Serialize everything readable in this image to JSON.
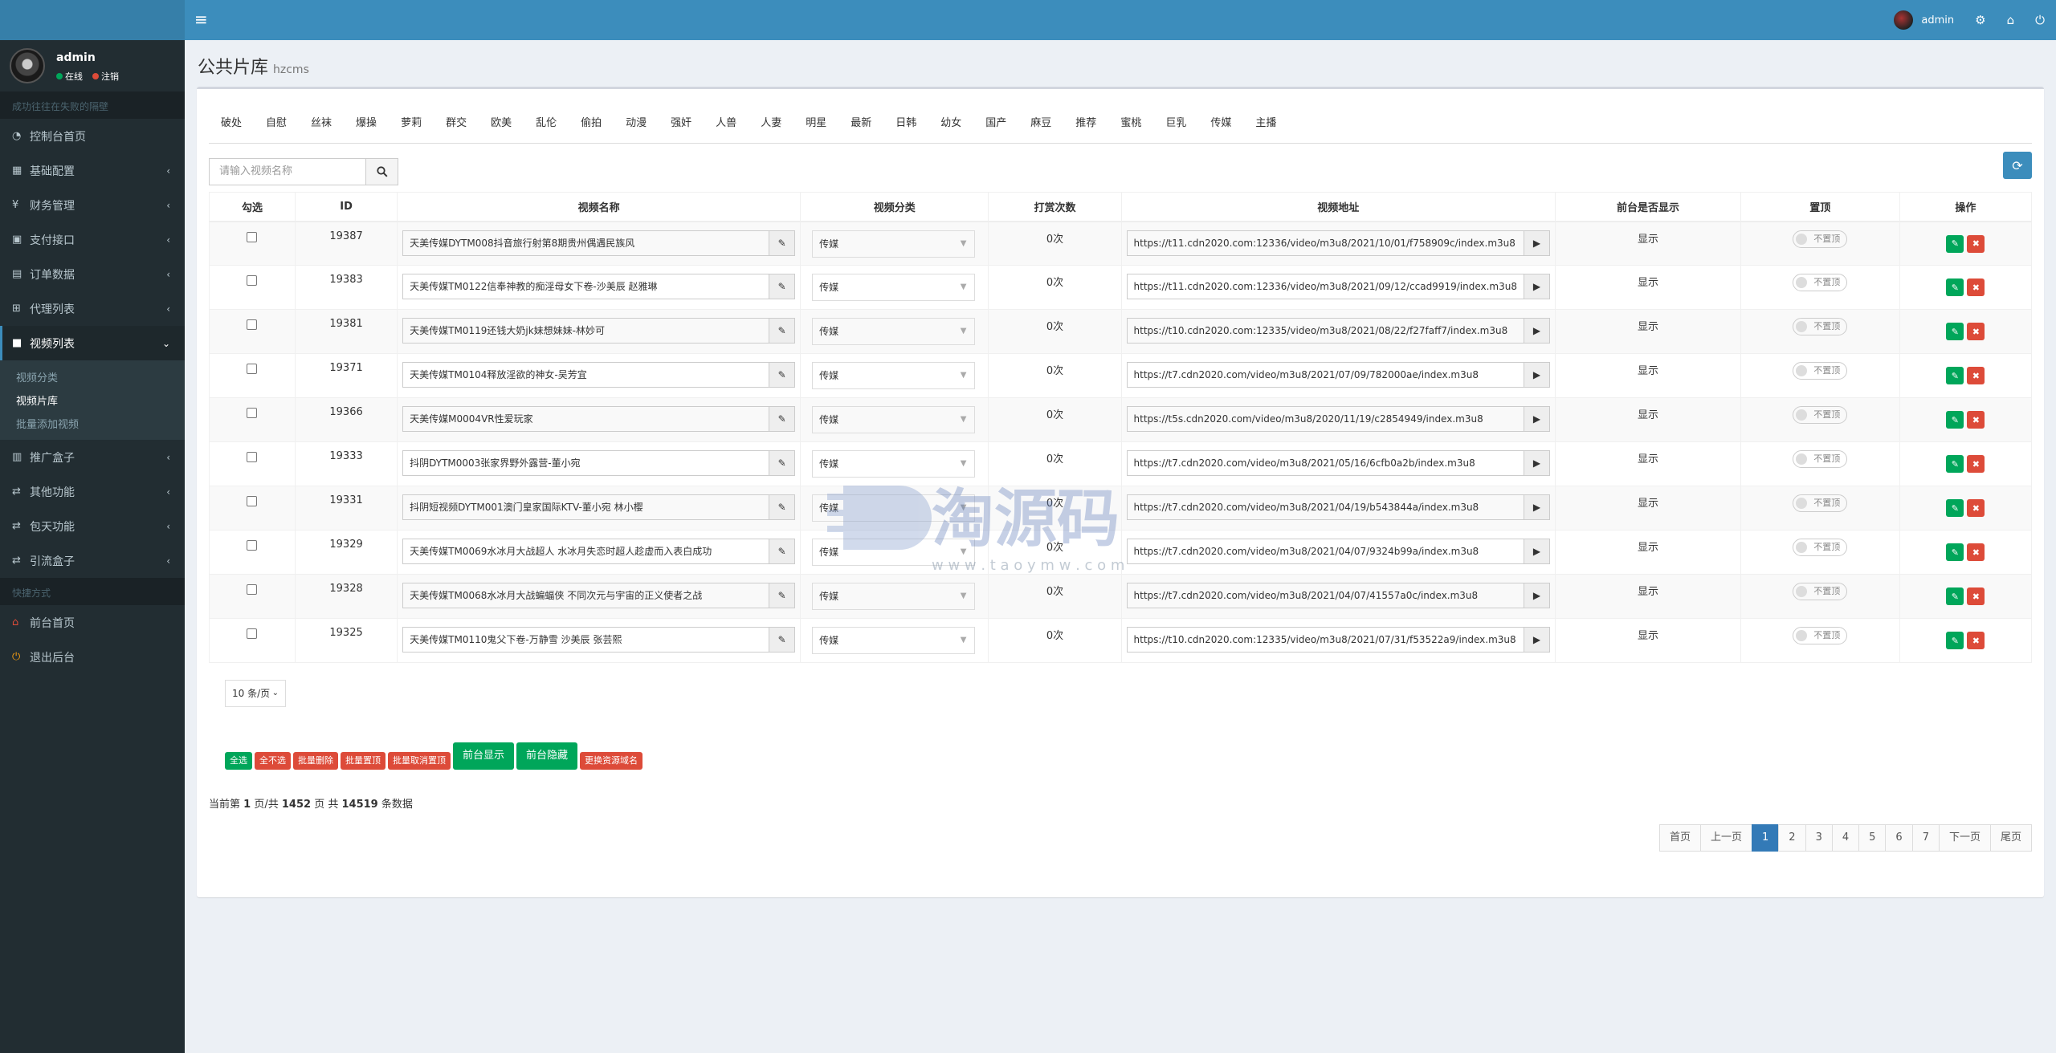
{
  "topbar": {
    "username": "admin"
  },
  "sidebar": {
    "user": {
      "name": "admin",
      "status_online": "在线",
      "status_logout": "注销"
    },
    "header1": "成功往往在失败的隔壁",
    "header2": "快捷方式",
    "items": [
      {
        "label": "控制台首页",
        "icon": "dashboard-icon"
      },
      {
        "label": "基础配置",
        "icon": "grid-icon"
      },
      {
        "label": "财务管理",
        "icon": "yen-icon"
      },
      {
        "label": "支付接口",
        "icon": "card-icon"
      },
      {
        "label": "订单数据",
        "icon": "chart-icon"
      },
      {
        "label": "代理列表",
        "icon": "sitemap-icon"
      },
      {
        "label": "视频列表",
        "icon": "video-icon"
      },
      {
        "label": "推广盒子",
        "icon": "table-icon"
      },
      {
        "label": "其他功能",
        "icon": "retweet-icon"
      },
      {
        "label": "包天功能",
        "icon": "retweet-icon"
      },
      {
        "label": "引流盒子",
        "icon": "retweet-icon"
      }
    ],
    "sub": [
      "视频分类",
      "视频片库",
      "批量添加视频"
    ],
    "shortcuts": [
      {
        "label": "前台首页",
        "icon": "home-icon"
      },
      {
        "label": "退出后台",
        "icon": "power-icon"
      }
    ]
  },
  "page": {
    "title": "公共片库",
    "subtitle": "hzcms"
  },
  "tabs": [
    "破处",
    "自慰",
    "丝袜",
    "爆操",
    "萝莉",
    "群交",
    "欧美",
    "乱伦",
    "偷拍",
    "动漫",
    "强奸",
    "人兽",
    "人妻",
    "明星",
    "最新",
    "日韩",
    "幼女",
    "国产",
    "麻豆",
    "推荐",
    "蜜桃",
    "巨乳",
    "传媒",
    "主播"
  ],
  "search": {
    "placeholder": "请输入视频名称"
  },
  "table": {
    "headers": [
      "勾选",
      "ID",
      "视频名称",
      "视频分类",
      "打赏次数",
      "视频地址",
      "前台是否显示",
      "置顶",
      "操作"
    ],
    "rows": [
      {
        "id": "19387",
        "name": "天美传媒DYTM008抖音旅行射第8期贵州偶遇民族风",
        "category": "传媒",
        "tips": "0次",
        "url": "https://t11.cdn2020.com:12336/video/m3u8/2021/10/01/f758909c/index.m3u8",
        "show": "显示",
        "top": "不置顶"
      },
      {
        "id": "19383",
        "name": "天美传媒TM0122信奉神教的痴淫母女下卷-沙美辰 赵雅琳",
        "category": "传媒",
        "tips": "0次",
        "url": "https://t11.cdn2020.com:12336/video/m3u8/2021/09/12/ccad9919/index.m3u8",
        "show": "显示",
        "top": "不置顶"
      },
      {
        "id": "19381",
        "name": "天美传媒TM0119还钱大奶jk妹想妹妹-林妙可",
        "category": "传媒",
        "tips": "0次",
        "url": "https://t10.cdn2020.com:12335/video/m3u8/2021/08/22/f27faff7/index.m3u8",
        "show": "显示",
        "top": "不置顶"
      },
      {
        "id": "19371",
        "name": "天美传媒TM0104释放淫欲的神女-吴芳宜",
        "category": "传媒",
        "tips": "0次",
        "url": "https://t7.cdn2020.com/video/m3u8/2021/07/09/782000ae/index.m3u8",
        "show": "显示",
        "top": "不置顶"
      },
      {
        "id": "19366",
        "name": "天美传媒M0004VR性爱玩家",
        "category": "传媒",
        "tips": "0次",
        "url": "https://t5s.cdn2020.com/video/m3u8/2020/11/19/c2854949/index.m3u8",
        "show": "显示",
        "top": "不置顶"
      },
      {
        "id": "19333",
        "name": "抖阴DYTM0003张家界野外露营-董小宛",
        "category": "传媒",
        "tips": "0次",
        "url": "https://t7.cdn2020.com/video/m3u8/2021/05/16/6cfb0a2b/index.m3u8",
        "show": "显示",
        "top": "不置顶"
      },
      {
        "id": "19331",
        "name": "抖阴短视频DYTM001澳门皇家国际KTV-董小宛 林小樱",
        "category": "传媒",
        "tips": "0次",
        "url": "https://t7.cdn2020.com/video/m3u8/2021/04/19/b543844a/index.m3u8",
        "show": "显示",
        "top": "不置顶"
      },
      {
        "id": "19329",
        "name": "天美传媒TM0069水冰月大战超人 水冰月失恋时超人趁虚而入表白成功",
        "category": "传媒",
        "tips": "0次",
        "url": "https://t7.cdn2020.com/video/m3u8/2021/04/07/9324b99a/index.m3u8",
        "show": "显示",
        "top": "不置顶"
      },
      {
        "id": "19328",
        "name": "天美传媒TM0068水冰月大战蝙蝠侠 不同次元与宇宙的正义使者之战",
        "category": "传媒",
        "tips": "0次",
        "url": "https://t7.cdn2020.com/video/m3u8/2021/04/07/41557a0c/index.m3u8",
        "show": "显示",
        "top": "不置顶"
      },
      {
        "id": "19325",
        "name": "天美传媒TM0110鬼父下卷-万静雪 沙美辰 张芸熙",
        "category": "传媒",
        "tips": "0次",
        "url": "https://t10.cdn2020.com:12335/video/m3u8/2021/07/31/f53522a9/index.m3u8",
        "show": "显示",
        "top": "不置顶"
      }
    ]
  },
  "pagesize": "10 条/页",
  "bulk": [
    "全选",
    "全不选",
    "批量删除",
    "批量置顶",
    "批量取消置顶",
    "前台显示",
    "前台隐藏",
    "更换资源域名"
  ],
  "summary": {
    "prefix": "当前第",
    "page": "1",
    "mid1": "页/共",
    "pages": "1452",
    "mid2": "页 共",
    "total": "14519",
    "suffix": "条数据"
  },
  "pager": [
    "首页",
    "上一页",
    "1",
    "2",
    "3",
    "4",
    "5",
    "6",
    "7",
    "下一页",
    "尾页"
  ],
  "watermark": {
    "text": "淘源码",
    "url": "w w w . t a o y m w . c o m"
  },
  "colors": {
    "primary": "#3c8dbc",
    "success": "#00a65a",
    "danger": "#dd4b39",
    "sidebar": "#222d32"
  }
}
